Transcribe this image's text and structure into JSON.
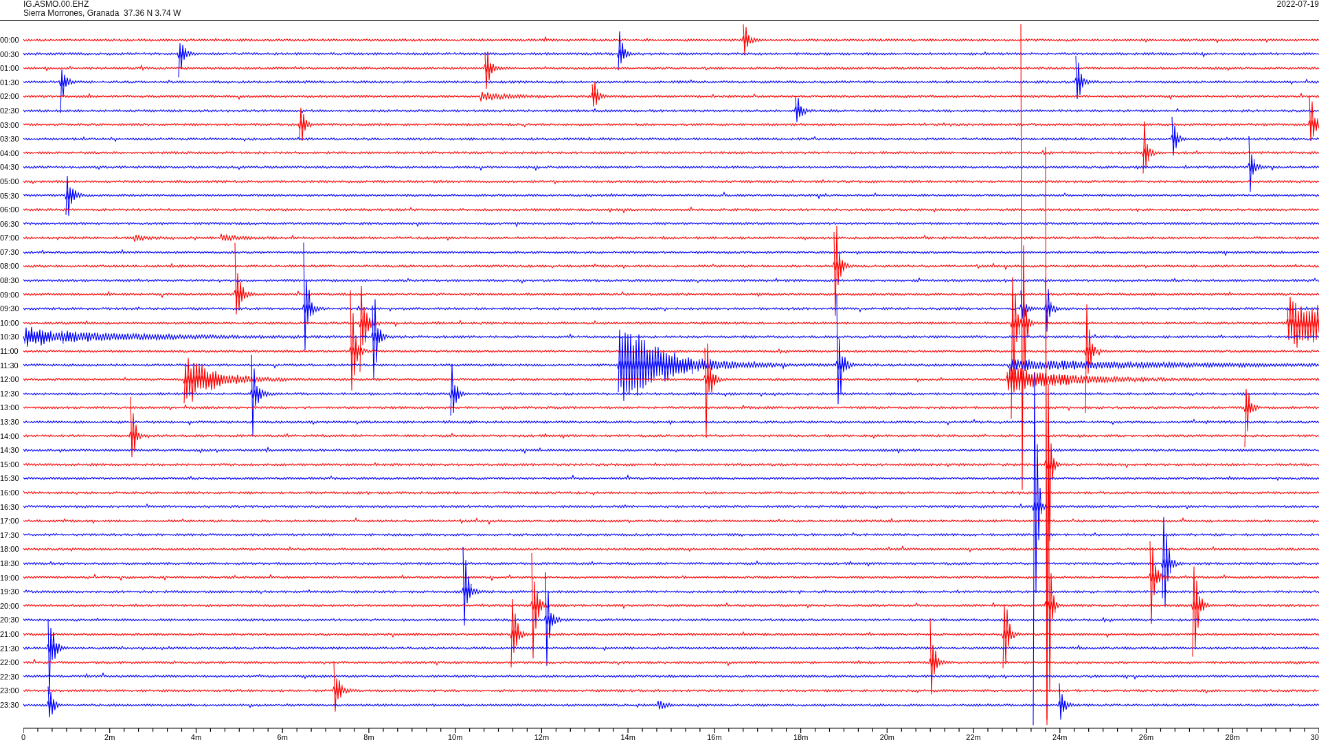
{
  "header": {
    "station": "IG.ASMO.00.EHZ",
    "location": "Sierra Morrones, Granada  37.36 N 3.74 W",
    "date": "2022-07-19"
  },
  "traces": [
    {
      "label": "00:00",
      "color": "#ff0000"
    },
    {
      "label": "00:30",
      "color": "#0000ff"
    },
    {
      "label": "01:00",
      "color": "#ff0000"
    },
    {
      "label": "01:30",
      "color": "#0000ff"
    },
    {
      "label": "02:00",
      "color": "#ff0000"
    },
    {
      "label": "02:30",
      "color": "#0000ff"
    },
    {
      "label": "03:00",
      "color": "#ff0000"
    },
    {
      "label": "03:30",
      "color": "#0000ff"
    },
    {
      "label": "04:00",
      "color": "#ff0000"
    },
    {
      "label": "04:30",
      "color": "#0000ff"
    },
    {
      "label": "05:00",
      "color": "#ff0000"
    },
    {
      "label": "05:30",
      "color": "#0000ff"
    },
    {
      "label": "06:00",
      "color": "#ff0000"
    },
    {
      "label": "06:30",
      "color": "#0000ff"
    },
    {
      "label": "07:00",
      "color": "#ff0000"
    },
    {
      "label": "07:30",
      "color": "#0000ff"
    },
    {
      "label": "08:00",
      "color": "#ff0000"
    },
    {
      "label": "08:30",
      "color": "#0000ff"
    },
    {
      "label": "09:00",
      "color": "#ff0000"
    },
    {
      "label": "09:30",
      "color": "#0000ff"
    },
    {
      "label": "10:00",
      "color": "#ff0000"
    },
    {
      "label": "10:30",
      "color": "#0000ff"
    },
    {
      "label": "11:00",
      "color": "#ff0000"
    },
    {
      "label": "11:30",
      "color": "#0000ff"
    },
    {
      "label": "12:00",
      "color": "#ff0000"
    },
    {
      "label": "12:30",
      "color": "#0000ff"
    },
    {
      "label": "13:00",
      "color": "#ff0000"
    },
    {
      "label": "13:30",
      "color": "#0000ff"
    },
    {
      "label": "14:00",
      "color": "#ff0000"
    },
    {
      "label": "14:30",
      "color": "#0000ff"
    },
    {
      "label": "15:00",
      "color": "#ff0000"
    },
    {
      "label": "15:30",
      "color": "#0000ff"
    },
    {
      "label": "16:00",
      "color": "#ff0000"
    },
    {
      "label": "16:30",
      "color": "#0000ff"
    },
    {
      "label": "17:00",
      "color": "#ff0000"
    },
    {
      "label": "17:30",
      "color": "#0000ff"
    },
    {
      "label": "18:00",
      "color": "#ff0000"
    },
    {
      "label": "18:30",
      "color": "#0000ff"
    },
    {
      "label": "19:00",
      "color": "#ff0000"
    },
    {
      "label": "19:30",
      "color": "#0000ff"
    },
    {
      "label": "20:00",
      "color": "#ff0000"
    },
    {
      "label": "20:30",
      "color": "#0000ff"
    },
    {
      "label": "21:00",
      "color": "#ff0000"
    },
    {
      "label": "21:30",
      "color": "#0000ff"
    },
    {
      "label": "22:00",
      "color": "#ff0000"
    },
    {
      "label": "22:30",
      "color": "#0000ff"
    },
    {
      "label": "23:00",
      "color": "#ff0000"
    },
    {
      "label": "23:30",
      "color": "#0000ff"
    }
  ],
  "x_axis": {
    "ticks": [
      "0",
      "2m",
      "4m",
      "6m",
      "8m",
      "10m",
      "12m",
      "14m",
      "16m",
      "18m",
      "20m",
      "22m",
      "24m",
      "26m",
      "28m",
      "30"
    ]
  }
}
